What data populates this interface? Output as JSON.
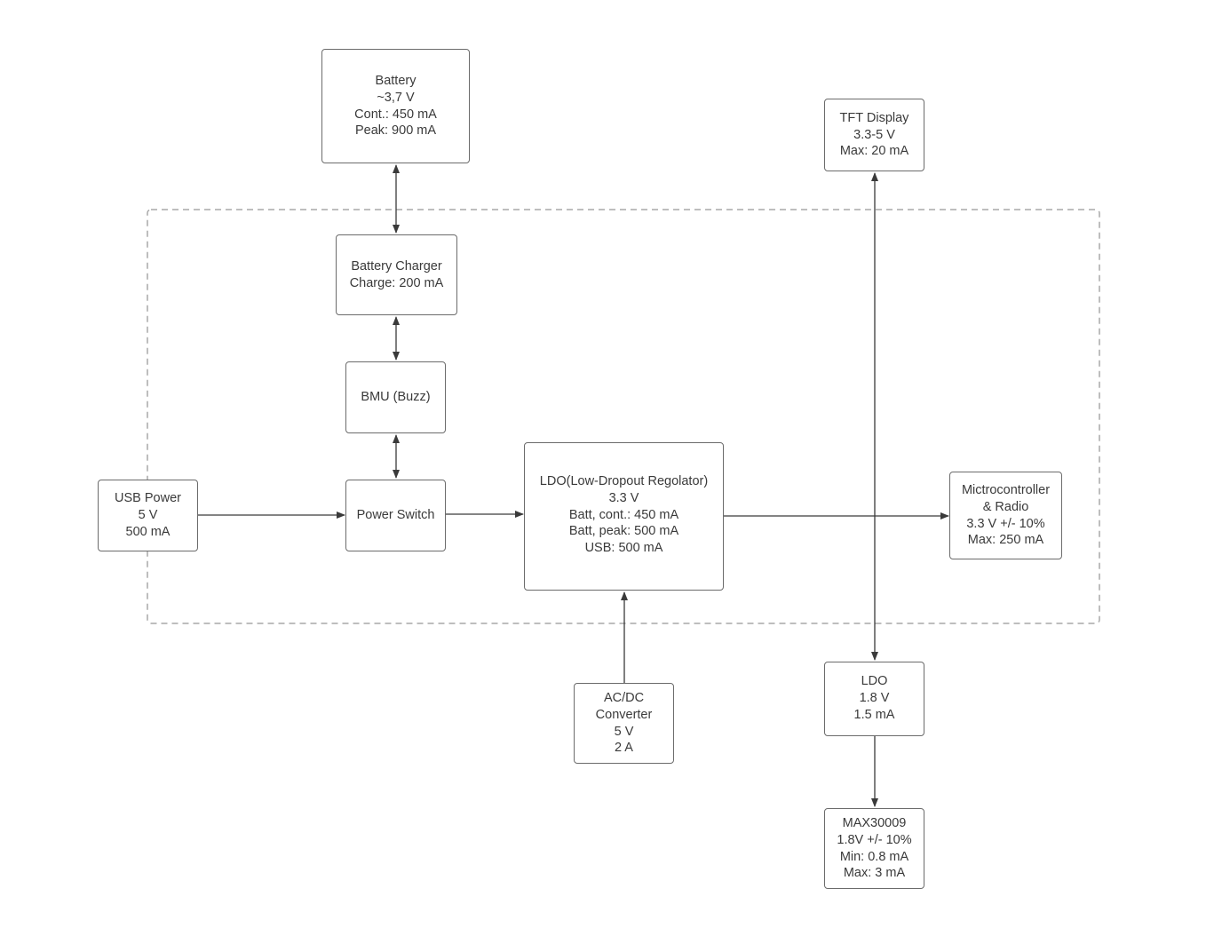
{
  "colors": {
    "line": "#3a3a3a",
    "border": "#6b6b6b",
    "dashed_boundary": "#a8a8a8",
    "text": "#3a3a3a"
  },
  "nodes": {
    "battery": {
      "lines": [
        "Battery",
        "~3,7 V",
        "Cont.: 450 mA",
        "Peak: 900 mA"
      ]
    },
    "charger": {
      "lines": [
        "Battery Charger",
        "Charge: 200 mA"
      ]
    },
    "bmu": {
      "lines": [
        "BMU (Buzz)"
      ]
    },
    "usb": {
      "lines": [
        "USB Power",
        "5 V",
        "500 mA"
      ]
    },
    "switch": {
      "lines": [
        "Power Switch"
      ]
    },
    "ldo_main": {
      "lines": [
        "LDO(Low-Dropout Regolator)",
        "3.3 V",
        "Batt, cont.: 450 mA",
        "Batt, peak: 500 mA",
        "USB: 500 mA"
      ]
    },
    "mcu": {
      "lines": [
        "Mictrocontroller",
        "& Radio",
        "3.3 V +/- 10%",
        "Max: 250 mA"
      ]
    },
    "tft": {
      "lines": [
        "TFT Display",
        "3.3-5 V",
        "Max: 20 mA"
      ]
    },
    "ldo_18": {
      "lines": [
        "LDO",
        "1.8 V",
        "1.5 mA"
      ]
    },
    "acdc": {
      "lines": [
        "AC/DC",
        "Converter",
        "5 V",
        "2 A"
      ]
    },
    "max": {
      "lines": [
        "MAX30009",
        "1.8V +/- 10%",
        "Min: 0.8 mA",
        "Max: 3 mA"
      ]
    }
  }
}
